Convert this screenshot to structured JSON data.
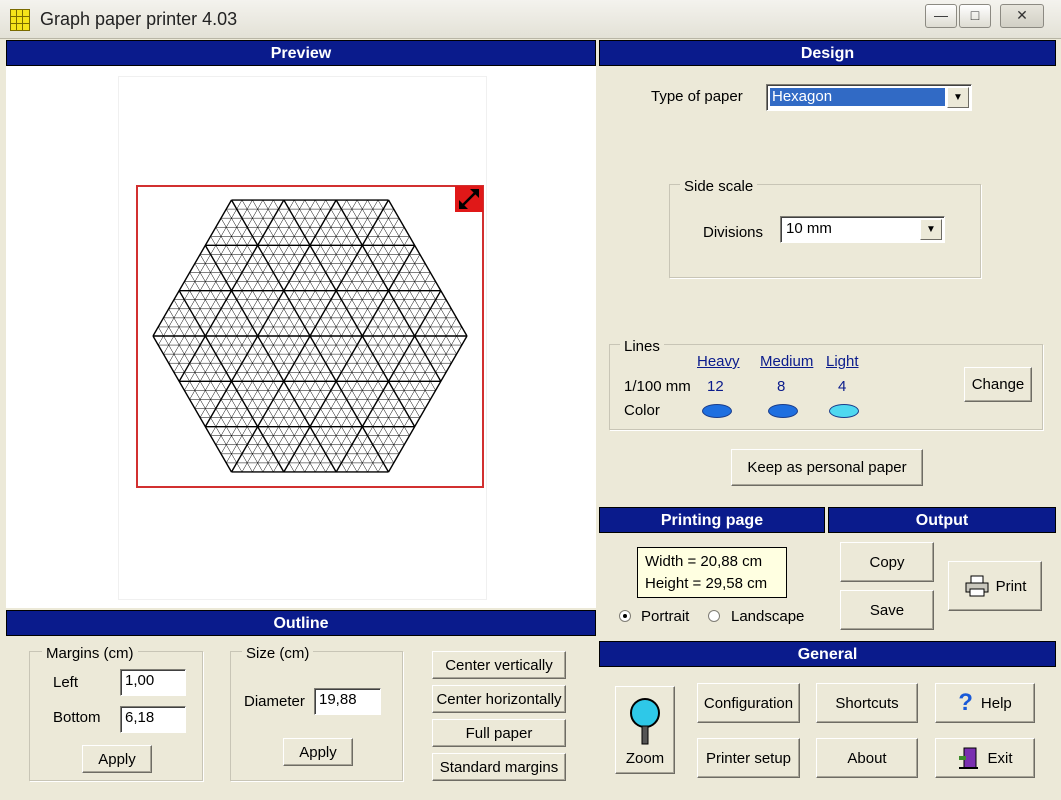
{
  "window": {
    "title": "Graph paper printer 4.03",
    "minimize": "—",
    "maximize": "□",
    "close": "✕"
  },
  "preview": {
    "header": "Preview"
  },
  "design": {
    "header": "Design",
    "type_label": "Type of paper",
    "type_value": "Hexagon",
    "side_scale": {
      "legend": "Side scale",
      "divisions_label": "Divisions",
      "divisions_value": "10 mm"
    },
    "lines": {
      "legend": "Lines",
      "heavy": "Heavy",
      "medium": "Medium",
      "light": "Light",
      "unit_label": "1/100 mm",
      "heavy_val": "12",
      "medium_val": "8",
      "light_val": "4",
      "color_label": "Color",
      "colors": {
        "heavy": "#1e6fe0",
        "medium": "#1e6fe0",
        "light": "#4fd8f0"
      },
      "change": "Change"
    },
    "keep_button": "Keep as personal paper"
  },
  "printing_page": {
    "header": "Printing page",
    "width": "Width = 20,88 cm",
    "height": "Height = 29,58 cm",
    "portrait": "Portrait",
    "landscape": "Landscape",
    "orientation": "portrait"
  },
  "output": {
    "header": "Output",
    "copy": "Copy",
    "save": "Save",
    "print": "Print"
  },
  "outline": {
    "header": "Outline",
    "margins": {
      "legend": "Margins (cm)",
      "left_label": "Left",
      "left_value": "1,00",
      "bottom_label": "Bottom",
      "bottom_value": "6,18",
      "apply": "Apply"
    },
    "size": {
      "legend": "Size (cm)",
      "diameter_label": "Diameter",
      "diameter_value": "19,88",
      "apply": "Apply"
    },
    "center_v": "Center vertically",
    "center_h": "Center horizontally",
    "full_paper": "Full paper",
    "standard_margins": "Standard margins"
  },
  "general": {
    "header": "General",
    "zoom": "Zoom",
    "configuration": "Configuration",
    "shortcuts": "Shortcuts",
    "help": "Help",
    "printer_setup": "Printer setup",
    "about": "About",
    "exit": "Exit"
  }
}
